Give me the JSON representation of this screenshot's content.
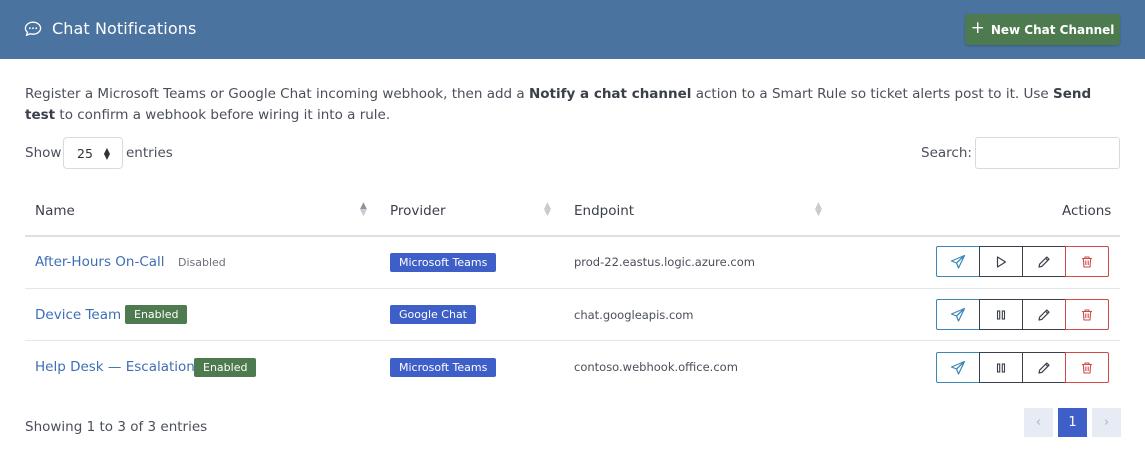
{
  "header": {
    "icon": "chat-bubble-icon",
    "title": "Chat Notifications",
    "new_button": {
      "icon": "plus-icon",
      "label": "New Chat Channel"
    }
  },
  "description": {
    "part1": "Register a Microsoft Teams or Google Chat incoming webhook, then add a ",
    "bold1": "Notify a chat channel",
    "part2": " action to a Smart Rule so ticket alerts post to it. Use ",
    "bold2": "Send test",
    "part3": " to confirm a webhook before wiring it into a rule."
  },
  "length_control": {
    "prefix": "Show",
    "value": "25",
    "suffix": "entries"
  },
  "search": {
    "label": "Search:",
    "value": ""
  },
  "table": {
    "columns": [
      "Name",
      "Provider",
      "Endpoint",
      "Actions"
    ],
    "sorted_column": "Name",
    "rows": [
      {
        "name": "After-Hours On-Call",
        "status": "Disabled",
        "provider": "Microsoft Teams",
        "endpoint": "prod-22.eastus.logic.azure.com",
        "toggle_icon": "play-icon"
      },
      {
        "name": "Device Team",
        "status": "Enabled",
        "provider": "Google Chat",
        "endpoint": "chat.googleapis.com",
        "toggle_icon": "pause-icon"
      },
      {
        "name": "Help Desk — Escalations",
        "status": "Enabled",
        "provider": "Microsoft Teams",
        "endpoint": "contoso.webhook.office.com",
        "toggle_icon": "pause-icon"
      }
    ]
  },
  "footer": {
    "info": "Showing 1 to 3 of 3 entries",
    "pagination": {
      "prev": "‹",
      "current": "1",
      "next": "›"
    }
  },
  "colors": {
    "header_bg": "#4a73a0",
    "new_button_bg": "#4d7a4f",
    "enabled_badge": "#4d7a4f",
    "provider_badge": "#3f5fc8",
    "link": "#3e6fb5",
    "send_border": "#3a86b5",
    "delete_border": "#d04a48"
  }
}
